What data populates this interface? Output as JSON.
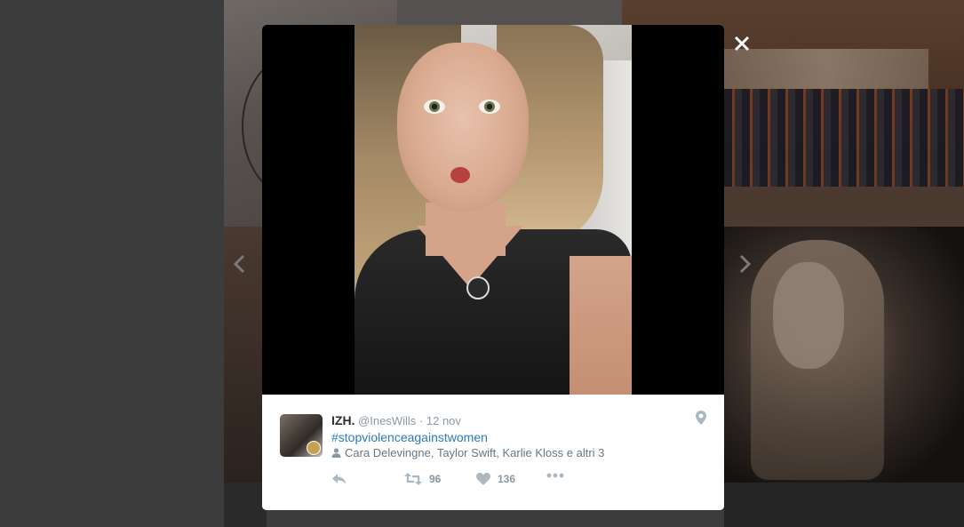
{
  "tweet": {
    "author_name": "IZH.",
    "handle": "@InesWills",
    "separator": "·",
    "timestamp": "12 nov",
    "hashtag": "#stopviolenceagainstwomen",
    "tagged_users": "Cara Delevingne, Taylor Swift, Karlie Kloss e altri 3",
    "retweet_count": "96",
    "like_count": "136"
  },
  "icons": {
    "close": "close-icon",
    "prev": "chevron-left-icon",
    "next": "chevron-right-icon",
    "location": "location-pin-icon",
    "user": "user-icon",
    "reply": "reply-icon",
    "retweet": "retweet-icon",
    "like": "heart-icon",
    "more": "more-dots-icon"
  },
  "colors": {
    "overlay": "#3c3c3c",
    "link": "#2b7bb9",
    "action_gray": "#aab8c2"
  }
}
